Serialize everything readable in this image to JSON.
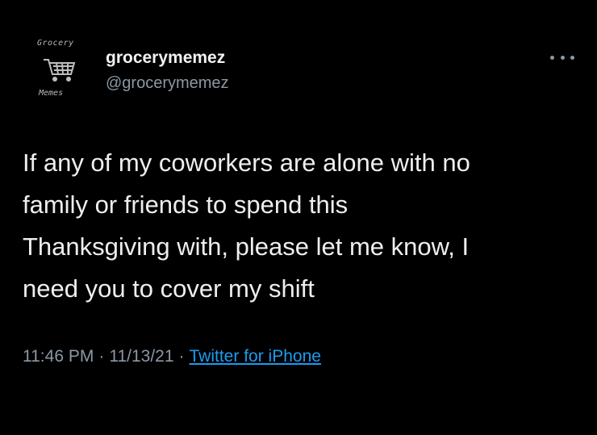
{
  "avatar": {
    "top_text": "Grocery",
    "bottom_text": "Memes",
    "icon": "shopping-cart-icon"
  },
  "user": {
    "display_name": "grocerymemez",
    "handle": "@grocerymemez"
  },
  "tweet": {
    "text": "If any of my coworkers are alone with no\nfamily or friends to spend this\nThanksgiving with, please let me know, I\nneed you to cover my shift"
  },
  "meta": {
    "time": "11:46 PM",
    "separator": "·",
    "date": "11/13/21",
    "source": "Twitter for iPhone"
  },
  "colors": {
    "background": "#000000",
    "text": "#e7e9ea",
    "secondary": "#8b98a5",
    "link": "#1d9bf0"
  }
}
